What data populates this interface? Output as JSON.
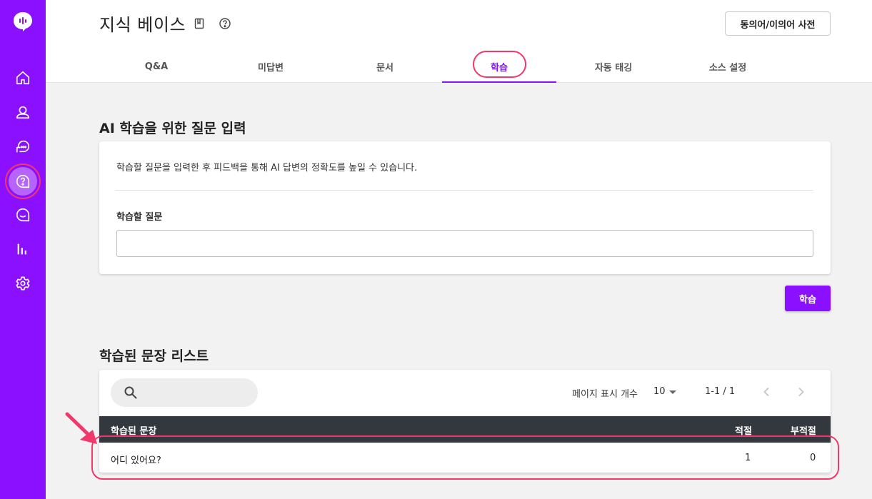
{
  "sidebar": {
    "items": [
      {
        "name": "home",
        "icon": "home-icon"
      },
      {
        "name": "user",
        "icon": "user-icon"
      },
      {
        "name": "chat",
        "icon": "chat-bubble-icon"
      },
      {
        "name": "knowledge-base",
        "icon": "question-help-icon",
        "active": true
      },
      {
        "name": "search-chat",
        "icon": "chat-search-icon"
      },
      {
        "name": "stats",
        "icon": "bar-chart-icon"
      },
      {
        "name": "settings",
        "icon": "gear-icon"
      }
    ]
  },
  "header": {
    "title": "지식 베이스",
    "dict_button": "동의어/이의어 사전"
  },
  "tabs": [
    {
      "label": "Q&A",
      "active": false
    },
    {
      "label": "미답변",
      "active": false
    },
    {
      "label": "문서",
      "active": false
    },
    {
      "label": "학습",
      "active": true
    },
    {
      "label": "자동 태깅",
      "active": false
    },
    {
      "label": "소스 설정",
      "active": false
    }
  ],
  "input_section": {
    "title": "AI 학습을 위한 질문 입력",
    "description": "학습할 질문을 입력한 후 피드백을 통해 AI 답변의 정확도를 높일 수 있습니다.",
    "field_label": "학습할 질문",
    "field_value": "",
    "submit_button": "학습"
  },
  "list_section": {
    "title": "학습된 문장 리스트",
    "search_value": "",
    "per_page_label": "페이지 표시 개수",
    "per_page_value": "10",
    "range": "1-1 / 1",
    "columns": [
      "학습된 문장",
      "적절",
      "부적절"
    ],
    "rows": [
      [
        "어디 있어요?",
        "1",
        "0"
      ]
    ]
  },
  "colors": {
    "brand": "#8b10ff",
    "highlight": "#f0386b",
    "table_header": "#33383f"
  }
}
